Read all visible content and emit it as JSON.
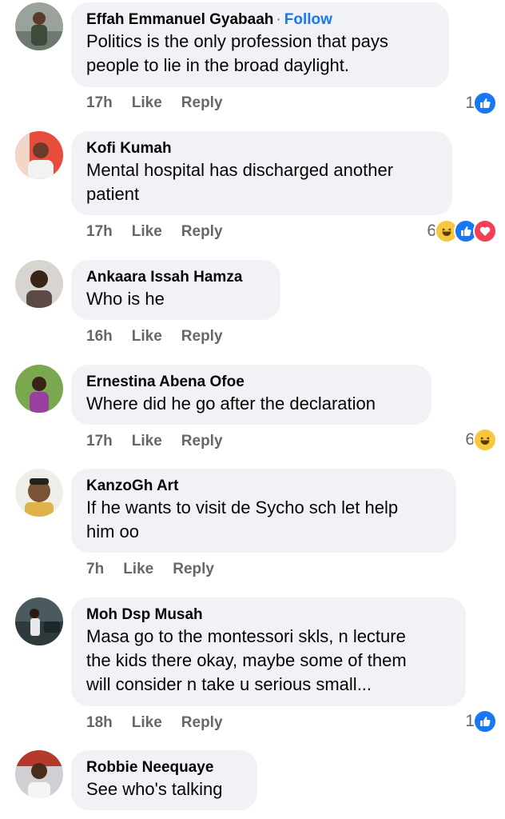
{
  "colors": {
    "accent": "#1877f2",
    "bubble": "#f0f2f5",
    "meta": "#65676b",
    "like_blue": "#1877f2",
    "haha_yellow": "#f7c83f",
    "love_red": "#f33e58"
  },
  "comments": [
    {
      "author": "Effah Emmanuel Gyabaah",
      "follow": "Follow",
      "separator": "·",
      "text": [
        "Politics is the only profession that pays",
        "people to lie in the broad daylight."
      ],
      "time": "17h",
      "like": "Like",
      "reply": "Reply",
      "reaction_count": "1",
      "reactions": [
        "like-icon"
      ]
    },
    {
      "author": "Kofi Kumah",
      "text": [
        "Mental hospital has discharged another",
        "patient"
      ],
      "time": "17h",
      "like": "Like",
      "reply": "Reply",
      "reaction_count": "6",
      "reactions": [
        "haha-icon",
        "like-icon",
        "love-icon"
      ]
    },
    {
      "author": "Ankaara Issah Hamza",
      "text": [
        "Who is he"
      ],
      "time": "16h",
      "like": "Like",
      "reply": "Reply"
    },
    {
      "author": "Ernestina Abena Ofoe",
      "text": [
        "Where did he go after the declaration"
      ],
      "time": "17h",
      "like": "Like",
      "reply": "Reply",
      "reaction_count": "6",
      "reactions": [
        "haha-icon"
      ]
    },
    {
      "author": "KanzoGh Art",
      "text": [
        "If he wants to visit de Sycho sch let help",
        "him oo"
      ],
      "time": "7h",
      "like": "Like",
      "reply": "Reply"
    },
    {
      "author": "Moh Dsp Musah",
      "text": [
        "Masa go to the montessori skls, n lecture",
        "the kids there okay, maybe some of them",
        "will consider n take u serious small..."
      ],
      "time": "18h",
      "like": "Like",
      "reply": "Reply",
      "reaction_count": "1",
      "reactions": [
        "like-icon"
      ]
    },
    {
      "author": "Robbie Neequaye",
      "text": [
        "See who's talking"
      ]
    }
  ]
}
